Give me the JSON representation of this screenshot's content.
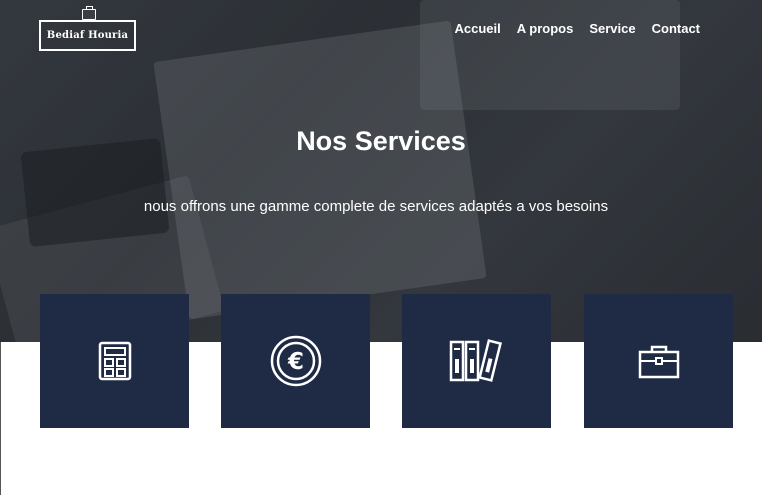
{
  "brand": {
    "name": "Bediaf Houria",
    "icon": "briefcase-icon"
  },
  "nav": {
    "items": [
      {
        "label": "Accueil"
      },
      {
        "label": "A propos"
      },
      {
        "label": "Service"
      },
      {
        "label": "Contact"
      }
    ]
  },
  "hero": {
    "title": "Nos Services",
    "subtitle": "nous offrons une gamme complete de services adaptés a vos besoins"
  },
  "services": [
    {
      "icon": "calculator-icon"
    },
    {
      "icon": "euro-coin-icon"
    },
    {
      "icon": "binders-icon"
    },
    {
      "icon": "briefcase-icon"
    }
  ],
  "colors": {
    "card_bg": "#1f2a44",
    "text_light": "#ffffff"
  }
}
